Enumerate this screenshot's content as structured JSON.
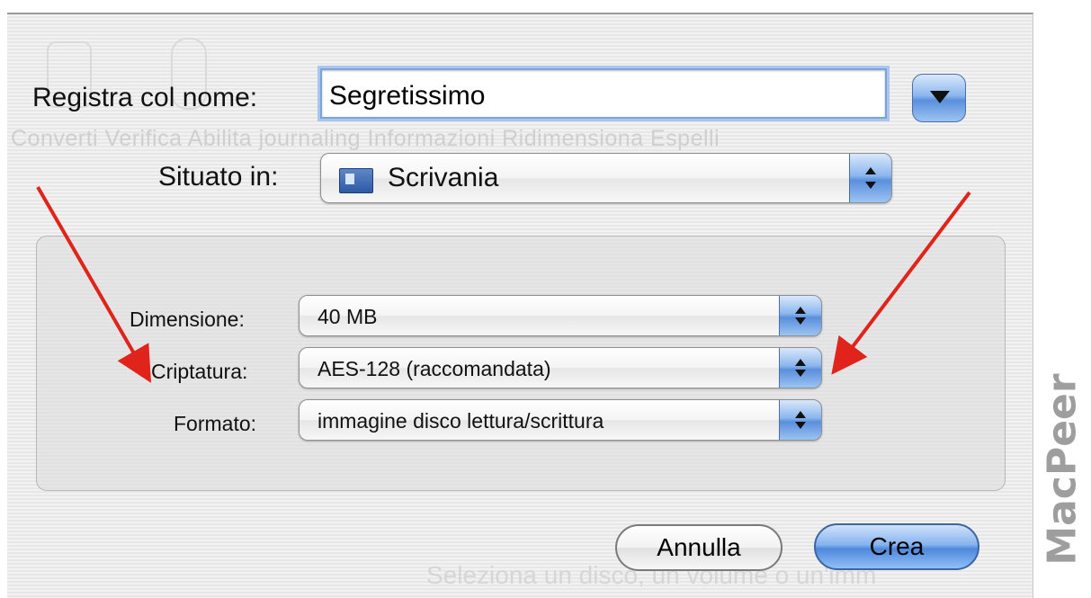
{
  "background_ghost": {
    "toolbar_text": "Converti  Verifica  Abilita journaling  Informazioni  Ridimensiona  Espelli",
    "status_text": "Seleziona un disco, un volume o un'imm"
  },
  "save_as": {
    "label": "Registra col nome:",
    "value": "Segretissimo"
  },
  "location": {
    "label": "Situato in:",
    "value": "Scrivania",
    "icon": "desktop-folder-icon"
  },
  "options": {
    "size": {
      "label": "Dimensione:",
      "value": "40 MB"
    },
    "encryption": {
      "label": "Criptatura:",
      "value": "AES-128 (raccomandata)"
    },
    "format": {
      "label": "Formato:",
      "value": "immagine disco lettura/scrittura"
    }
  },
  "buttons": {
    "cancel": "Annulla",
    "create": "Crea"
  },
  "watermark": "MacPeer",
  "colors": {
    "accent": "#5a8fdc",
    "arrow": "#e0231b"
  }
}
